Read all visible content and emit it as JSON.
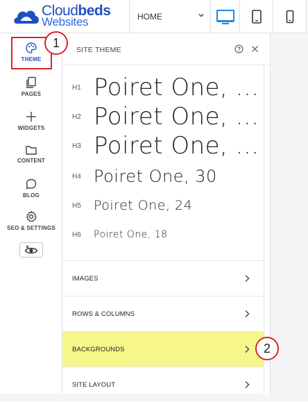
{
  "brand": {
    "line1_a": "Cloud",
    "line1_b": "beds",
    "line2": "Websites",
    "color": "#1f4fc2"
  },
  "topbar": {
    "page_select_value": "HOME"
  },
  "devices": [
    "desktop-icon",
    "tablet-icon",
    "mobile-icon"
  ],
  "rail": {
    "items": [
      {
        "label": "THEME",
        "icon": "palette-icon"
      },
      {
        "label": "PAGES",
        "icon": "pages-icon"
      },
      {
        "label": "WIDGETS",
        "icon": "plus-icon"
      },
      {
        "label": "CONTENT",
        "icon": "folder-icon"
      },
      {
        "label": "BLOG",
        "icon": "chat-bubble-icon"
      },
      {
        "label": "SEO & SETTINGS",
        "icon": "gear-icon"
      }
    ],
    "preview_icon": "eye-icon"
  },
  "panel": {
    "title": "SITE THEME",
    "fonts": [
      {
        "tag": "H1",
        "text": "Poiret One, ..."
      },
      {
        "tag": "H2",
        "text": "Poiret One, ..."
      },
      {
        "tag": "H3",
        "text": "Poiret One, ..."
      },
      {
        "tag": "H4",
        "text": "Poiret One, 30"
      },
      {
        "tag": "H5",
        "text": "Poiret One, 24"
      },
      {
        "tag": "H6",
        "text": "Poiret One, 18"
      }
    ],
    "sections": [
      "IMAGES",
      "ROWS & COLUMNS",
      "BACKGROUNDS",
      "SITE LAYOUT"
    ]
  },
  "callouts": [
    "1",
    "2"
  ],
  "colors": {
    "accent": "#1f4fc2",
    "callout": "#d8232a",
    "highlight": "#f6f68a"
  }
}
